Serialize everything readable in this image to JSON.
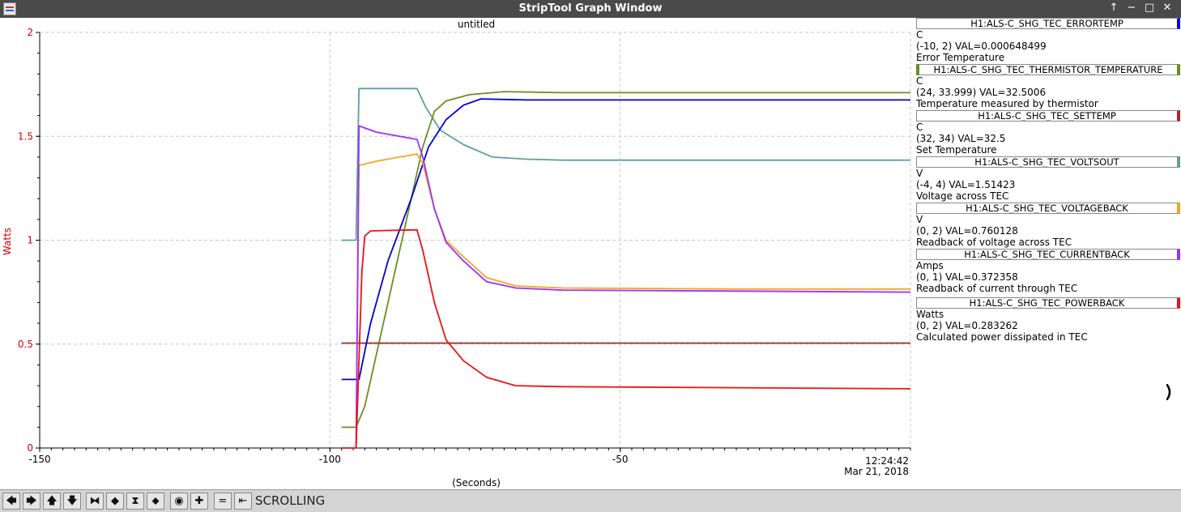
{
  "window": {
    "title": "StripTool Graph Window",
    "controls": [
      "↑",
      "−",
      "□",
      "✕"
    ]
  },
  "graph": {
    "title": "untitled",
    "ylabel": "Watts",
    "xlabel": "(Seconds)",
    "time": "12:24:42",
    "date": "Mar 21, 2018",
    "y_ticks": [
      "2",
      "1.5",
      "1",
      "0.5",
      "0"
    ],
    "x_ticks": [
      "-150",
      "-100",
      "-50"
    ]
  },
  "chart_data": {
    "type": "line",
    "xlabel": "(Seconds)",
    "ylabel": "Watts",
    "xlim": [
      -150,
      0
    ],
    "ylim": [
      0,
      2
    ],
    "grid": true,
    "series": [
      {
        "name": "H1:ALS-C_SHG_TEC_VOLTSOUT",
        "color": "#5f9ea0",
        "points": [
          [
            -98,
            1.0
          ],
          [
            -95.5,
            1.0
          ],
          [
            -95,
            1.73
          ],
          [
            -85,
            1.73
          ],
          [
            -83.5,
            1.64
          ],
          [
            -81,
            1.53
          ],
          [
            -77,
            1.46
          ],
          [
            -72,
            1.4
          ],
          [
            -66,
            1.39
          ],
          [
            -60,
            1.385
          ],
          [
            -50,
            1.385
          ],
          [
            0,
            1.385
          ]
        ]
      },
      {
        "name": "H1:ALS-C_SHG_TEC_THERMISTOR_TEMPERATURE",
        "color": "#6b8e23",
        "points": [
          [
            -98,
            0.1
          ],
          [
            -95.5,
            0.1
          ],
          [
            -94,
            0.2
          ],
          [
            -90,
            0.7
          ],
          [
            -86,
            1.2
          ],
          [
            -84,
            1.45
          ],
          [
            -82,
            1.62
          ],
          [
            -80,
            1.67
          ],
          [
            -76,
            1.7
          ],
          [
            -70,
            1.715
          ],
          [
            -60,
            1.71
          ],
          [
            0,
            1.71
          ]
        ]
      },
      {
        "name": "H1:ALS-C_SHG_TEC_SETTEMP",
        "color": "#a52a2a",
        "points": [
          [
            -98,
            0.505
          ],
          [
            0,
            0.505
          ]
        ]
      },
      {
        "name": "H1:ALS-C_SHG_TEC_ERRORTEMP",
        "color": "#0000cd",
        "points": [
          [
            -98,
            0.33
          ],
          [
            -95,
            0.33
          ],
          [
            -93,
            0.6
          ],
          [
            -90,
            0.9
          ],
          [
            -86,
            1.2
          ],
          [
            -83,
            1.45
          ],
          [
            -80,
            1.58
          ],
          [
            -77,
            1.65
          ],
          [
            -74,
            1.68
          ],
          [
            -66,
            1.675
          ],
          [
            -50,
            1.675
          ],
          [
            0,
            1.675
          ]
        ]
      },
      {
        "name": "H1:ALS-C_SHG_TEC_VOLTAGEBACK",
        "color": "#f5a623",
        "points": [
          [
            -95.5,
            0.0
          ],
          [
            -95,
            1.36
          ],
          [
            -92,
            1.38
          ],
          [
            -88,
            1.4
          ],
          [
            -85,
            1.415
          ],
          [
            -84,
            1.37
          ],
          [
            -82,
            1.15
          ],
          [
            -80,
            1.0
          ],
          [
            -77,
            0.92
          ],
          [
            -73,
            0.82
          ],
          [
            -68,
            0.78
          ],
          [
            -60,
            0.77
          ],
          [
            -30,
            0.765
          ],
          [
            0,
            0.765
          ]
        ]
      },
      {
        "name": "H1:ALS-C_SHG_TEC_CURRENTBACK",
        "color": "#9b30ff",
        "points": [
          [
            -95.5,
            0.0
          ],
          [
            -95,
            1.55
          ],
          [
            -92,
            1.52
          ],
          [
            -88,
            1.5
          ],
          [
            -85,
            1.485
          ],
          [
            -84,
            1.4
          ],
          [
            -82,
            1.15
          ],
          [
            -80,
            0.99
          ],
          [
            -77,
            0.9
          ],
          [
            -73,
            0.8
          ],
          [
            -68,
            0.77
          ],
          [
            -60,
            0.76
          ],
          [
            -30,
            0.755
          ],
          [
            0,
            0.75
          ]
        ]
      },
      {
        "name": "H1:ALS-C_SHG_TEC_POWERBACK",
        "color": "#ee1111",
        "points": [
          [
            -98,
            0.0
          ],
          [
            -95.5,
            0.0
          ],
          [
            -94.5,
            0.85
          ],
          [
            -94,
            1.02
          ],
          [
            -93,
            1.045
          ],
          [
            -85,
            1.05
          ],
          [
            -84,
            0.95
          ],
          [
            -82,
            0.7
          ],
          [
            -80,
            0.52
          ],
          [
            -77,
            0.42
          ],
          [
            -73,
            0.34
          ],
          [
            -68,
            0.3
          ],
          [
            -60,
            0.295
          ],
          [
            0,
            0.285
          ]
        ]
      }
    ]
  },
  "legend": [
    {
      "name": "H1:ALS-C_SHG_TEC_ERRORTEMP",
      "color": "#0000ff",
      "units": "C",
      "range_val": "(-10, 2) VAL=0.000648499",
      "desc": "Error Temperature"
    },
    {
      "name": "H1:ALS-C_SHG_TEC_THERMISTOR_TEMPERATURE",
      "color": "#6b8e23",
      "units": "C",
      "range_val": "(24, 33.999) VAL=32.5006",
      "desc": "Temperature measured by thermistor"
    },
    {
      "name": "H1:ALS-C_SHG_TEC_SETTEMP",
      "color": "#a52a2a",
      "units": "C",
      "range_val": "(32, 34)  VAL=32.5",
      "desc": "Set Temperature"
    },
    {
      "name": "H1:ALS-C_SHG_TEC_VOLTSOUT",
      "color": "#5f9ea0",
      "units": "V",
      "range_val": "(-4, 4) VAL=1.51423",
      "desc": "Voltage across TEC"
    },
    {
      "name": "H1:ALS-C_SHG_TEC_VOLTAGEBACK",
      "color": "#f5a623",
      "units": "V",
      "range_val": "(0, 2) VAL=0.760128",
      "desc": "Readback of voltage across TEC"
    },
    {
      "name": "H1:ALS-C_SHG_TEC_CURRENTBACK",
      "color": "#9b30ff",
      "units": "Amps",
      "range_val": "(0, 1) VAL=0.372358",
      "desc": "Readback of current through TEC"
    },
    {
      "name": "H1:ALS-C_SHG_TEC_POWERBACK",
      "color": "#ee1111",
      "units": "Watts",
      "range_val": "(0, 2) VAL=0.283262",
      "desc": "Calculated power dissipated in TEC"
    }
  ],
  "toolbar": {
    "buttons": [
      {
        "name": "pan-left-button",
        "glyph": "🡄"
      },
      {
        "name": "pan-right-button",
        "glyph": "🡆"
      },
      {
        "name": "pan-up-button",
        "glyph": "🡅"
      },
      {
        "name": "pan-down-button",
        "glyph": "🡇"
      },
      {
        "name": "zoom-in-x-button",
        "glyph": "⧓"
      },
      {
        "name": "zoom-out-x-button",
        "glyph": "◆"
      },
      {
        "name": "zoom-in-y-button",
        "glyph": "⧗"
      },
      {
        "name": "zoom-out-y-button",
        "glyph": "⬥"
      },
      {
        "name": "auto-scale-button",
        "glyph": "◉"
      },
      {
        "name": "reset-button",
        "glyph": "✚"
      },
      {
        "name": "refresh-button",
        "glyph": "≂"
      },
      {
        "name": "last-button",
        "glyph": "⇤"
      }
    ],
    "status": "SCROLLING"
  }
}
